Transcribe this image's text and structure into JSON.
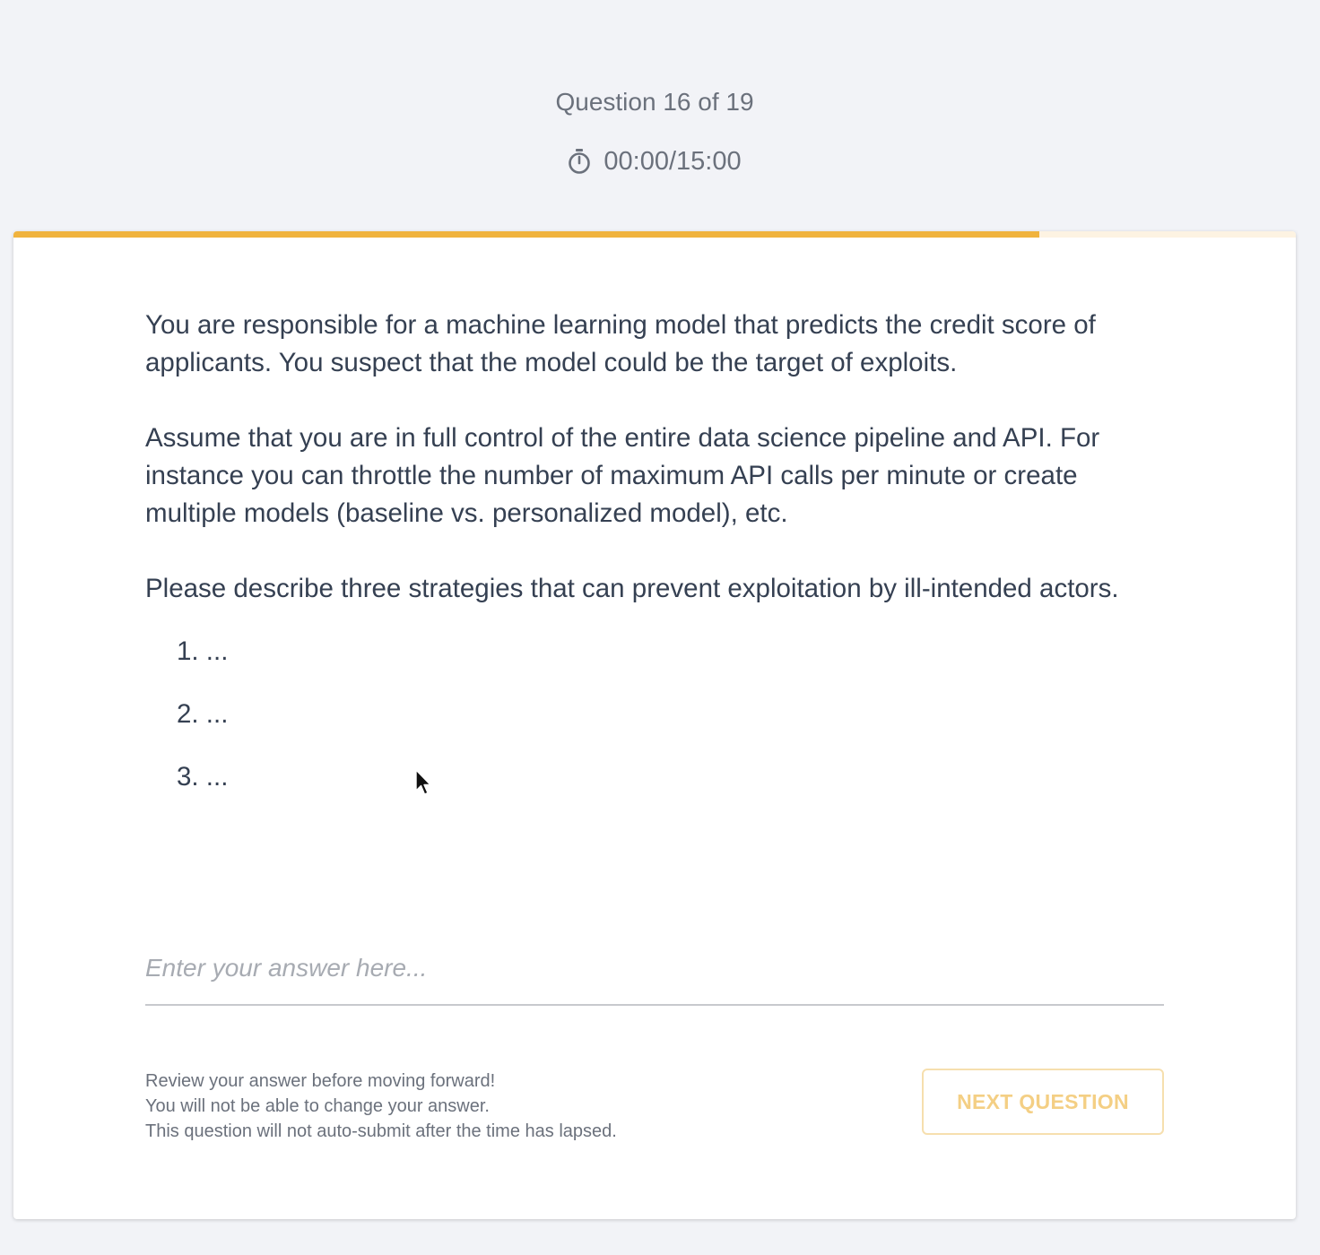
{
  "header": {
    "question_counter": "Question 16 of 19",
    "timer_icon": "stopwatch-icon",
    "timer": "00:00/15:00"
  },
  "progress": {
    "current": 16,
    "total": 19,
    "fraction": 0.8,
    "fill_color": "#f0b33e",
    "track_color": "#fdf3e2"
  },
  "question": {
    "paragraphs": [
      "You are responsible for a machine learning model that predicts the credit score of applicants. You suspect that the model could be the target of exploits.",
      "Assume that you are in full control of the entire data science pipeline and API. For instance you can throttle the number of maximum API calls per minute or create multiple models (baseline vs. personalized model), etc.",
      "Please describe three strategies that can prevent exploitation by ill-intended actors."
    ],
    "list_items": [
      "1. ...",
      "2. ...",
      "3. ..."
    ]
  },
  "answer": {
    "value": "",
    "placeholder": "Enter your answer here..."
  },
  "footer": {
    "notes": [
      "Review your answer before moving forward!",
      "You will not be able to change your answer.",
      "This question will not auto-submit after the time has lapsed."
    ],
    "next_button_label": "NEXT QUESTION",
    "accent_color": "#f0b33e"
  }
}
